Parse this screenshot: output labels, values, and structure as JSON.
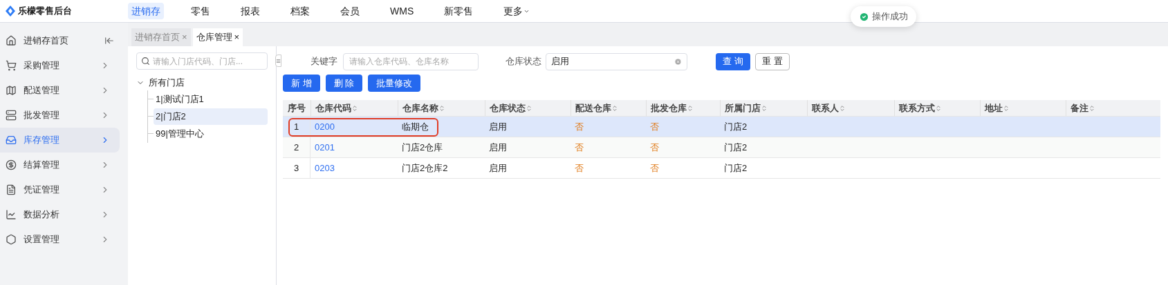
{
  "brand": {
    "name": "乐檬零售后台"
  },
  "top_nav": [
    {
      "label": "进销存",
      "selected": true
    },
    {
      "label": "零售",
      "selected": false
    },
    {
      "label": "报表",
      "selected": false
    },
    {
      "label": "档案",
      "selected": false
    },
    {
      "label": "会员",
      "selected": false
    },
    {
      "label": "WMS",
      "selected": false
    },
    {
      "label": "新零售",
      "selected": false
    },
    {
      "label": "更多",
      "selected": false,
      "dropdown": true
    }
  ],
  "toast": {
    "text": "操作成功"
  },
  "sidebar": {
    "home": "进销存首页",
    "items": [
      {
        "label": "采购管理",
        "selected": false
      },
      {
        "label": "配送管理",
        "selected": false
      },
      {
        "label": "批发管理",
        "selected": false
      },
      {
        "label": "库存管理",
        "selected": true
      },
      {
        "label": "结算管理",
        "selected": false
      },
      {
        "label": "凭证管理",
        "selected": false
      },
      {
        "label": "数据分析",
        "selected": false
      },
      {
        "label": "设置管理",
        "selected": false
      }
    ]
  },
  "page_tabs": [
    {
      "label": "进销存首页",
      "selected": false,
      "close": "×"
    },
    {
      "label": "仓库管理",
      "selected": true,
      "close": "×"
    }
  ],
  "tree": {
    "search_placeholder": "请输入门店代码、门店...",
    "root": {
      "label": "所有门店",
      "expanded": true,
      "children": [
        {
          "label": "1|测试门店1",
          "selected": false
        },
        {
          "label": "2|门店2",
          "selected": true
        },
        {
          "label": "99|管理中心",
          "selected": false
        }
      ]
    }
  },
  "filters": {
    "keyword_label": "关键字",
    "keyword_placeholder": "请输入仓库代码、仓库名称",
    "status_label": "仓库状态",
    "status_value": "启用",
    "query": "查 询",
    "reset": "重 置"
  },
  "actions": [
    "新 增",
    "删 除",
    "批量修改"
  ],
  "table": {
    "columns": [
      {
        "label": "序号",
        "kind": "index",
        "sortable": false
      },
      {
        "label": "仓库代码",
        "kind": "link",
        "sortable": true
      },
      {
        "label": "仓库名称",
        "kind": "text",
        "sortable": true
      },
      {
        "label": "仓库状态",
        "kind": "text",
        "sortable": true
      },
      {
        "label": "配送仓库",
        "kind": "flag",
        "sortable": true
      },
      {
        "label": "批发仓库",
        "kind": "flag",
        "sortable": true
      },
      {
        "label": "所属门店",
        "kind": "text",
        "sortable": true
      },
      {
        "label": "联系人",
        "kind": "text",
        "sortable": true
      },
      {
        "label": "联系方式",
        "kind": "text",
        "sortable": true
      },
      {
        "label": "地址",
        "kind": "text",
        "sortable": true
      },
      {
        "label": "备注",
        "kind": "text",
        "sortable": true
      }
    ],
    "rows": [
      {
        "selected": true,
        "outlined": true,
        "cells": [
          "1",
          "0200",
          "临期仓",
          "启用",
          "否",
          "否",
          "门店2",
          "",
          "",
          "",
          ""
        ]
      },
      {
        "selected": false,
        "outlined": false,
        "cells": [
          "2",
          "0201",
          "门店2仓库",
          "启用",
          "否",
          "否",
          "门店2",
          "",
          "",
          "",
          ""
        ]
      },
      {
        "selected": false,
        "outlined": false,
        "cells": [
          "3",
          "0203",
          "门店2仓库2",
          "启用",
          "否",
          "否",
          "门店2",
          "",
          "",
          "",
          ""
        ]
      }
    ]
  }
}
